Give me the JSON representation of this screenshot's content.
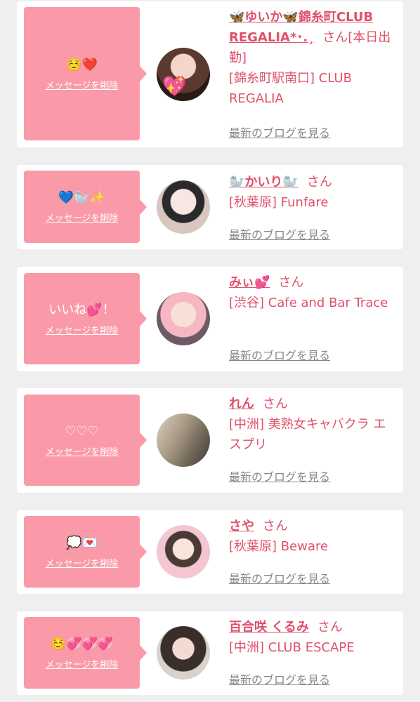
{
  "delete_label": "メッセージを削除",
  "blog_label": "最新のブログを見る",
  "cards": [
    {
      "message": "☺️❤️",
      "name": "🦋ゆいか🦋錦糸町CLUB REGALIA*･.¸",
      "suffix": "さん[本日出勤]",
      "shop": "[錦糸町駅南口] CLUB REGALIA"
    },
    {
      "message": "💙🦭✨",
      "name": "🦭かいり🦭",
      "suffix": "さん",
      "shop": "[秋葉原] Funfare"
    },
    {
      "message": "いいね💕！",
      "name": "みぃ💕",
      "suffix": "さん",
      "shop": "[渋谷] Cafe and Bar Trace"
    },
    {
      "message": "♡♡♡",
      "name": "れん",
      "suffix": "さん",
      "shop": "[中洲] 美熟女キャバクラ エスプリ"
    },
    {
      "message": "💭💌",
      "name": "さや",
      "suffix": "さん",
      "shop": "[秋葉原] Beware"
    },
    {
      "message": "☺️💞💞💞",
      "name": "百合咲 くるみ",
      "suffix": "さん",
      "shop": "[中洲] CLUB ESCAPE"
    }
  ]
}
